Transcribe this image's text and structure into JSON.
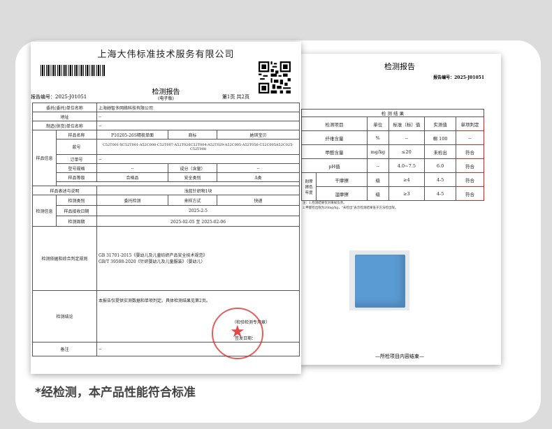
{
  "caption": "*经检测，本产品性能符合标准",
  "doc1": {
    "company": "上海大伟标准技术服务有限公司",
    "title": "检测报告",
    "subtitle": "(电子版)",
    "report_no": "报告编号：2025-J01051",
    "page": "第1页 共2页",
    "rows": {
      "client_label": "委托(委托)单位名称",
      "client": "上海她智多网络科技有限公司",
      "addr_label": "地址",
      "addr": "--",
      "maker_label": "制造(供货)单位名称",
      "maker": "--",
      "sample_group": "样品信息",
      "name_label": "样品名称",
      "name": "P10205-26S精梳单面",
      "brand_label": "商标",
      "brand": "她琪宝贝",
      "style_label": "款号",
      "style": "C52T001-XC52T001-A52C008-C52T007-A52T026C52T004-A52T029-A52C005-A52T056-C52C005A52C025-C52T008",
      "order_label": "订单号",
      "order": "--",
      "spec_label": "型号规格",
      "spec": "--",
      "comp_label": "成分（含量）",
      "comp": "--",
      "grade_label": "样品等级",
      "grade": "合格品",
      "safe_label": "安全类别",
      "safe": "A类",
      "desc_label": "样品表述与说明",
      "desc": "浅蓝针织物1块",
      "test_group": "检测信息",
      "type_label": "检测类别",
      "type": "委托检测",
      "sampling_label": "来样方式",
      "sampling": "快递",
      "recv_label": "样品接收日期",
      "recv": "2025-2-5",
      "period_label": "检测周期",
      "period": "2025-02-05 至 2025-02-06",
      "basis_label": "检测依据和综合判定规则",
      "basis1": "GB 31701-2015《婴幼儿及儿童纺织产品安全技术规范》",
      "basis2": "GB/T 39508-2020《针织婴幼儿及儿童服装》（婴幼儿）",
      "concl_label": "检测结论",
      "concl": "本报告仅提供实测数据和单项判定。具体检测结果见第2页。",
      "concl_sub": "（检验检测专用章）",
      "sign": "签发日期：",
      "note_label": "备注",
      "note": "--"
    }
  },
  "doc2": {
    "title": "检测报告",
    "report_no": "报告编号：2025-J01051",
    "section": "检 测 结 果",
    "headers": [
      "检测项目",
      "单位",
      "标准（标）值",
      "实测值",
      "单项判定"
    ],
    "rows": [
      {
        "item": "纤维含量",
        "unit": "%",
        "std": "--",
        "val": "棉 100",
        "judge": "--"
      },
      {
        "item": "甲醛含量",
        "unit": "mg/kg",
        "std": "≤20",
        "val": "未检出",
        "judge": "符合"
      },
      {
        "item": "pH值",
        "unit": "--",
        "std": "4.0~7.5",
        "val": "6.0",
        "judge": "符合"
      },
      {
        "item": "干摩擦",
        "unit": "级",
        "std": "≥4",
        "val": "4-5",
        "judge": "符合"
      },
      {
        "item": "湿摩擦",
        "unit": "级",
        "std": "≥3",
        "val": "4-5",
        "judge": "符合"
      }
    ],
    "group": "耐摩擦色牢度",
    "note1": "注：1.检测结果仅对来样负责。",
    "note2": "2.甲醛检出限为20mg/kg，\"未检出\"表示检测结果低于方法检出限。",
    "end": "—所检项目内容结束—"
  },
  "colors": {
    "stamp": "#dc2828",
    "judge_box": "#dd2222"
  }
}
